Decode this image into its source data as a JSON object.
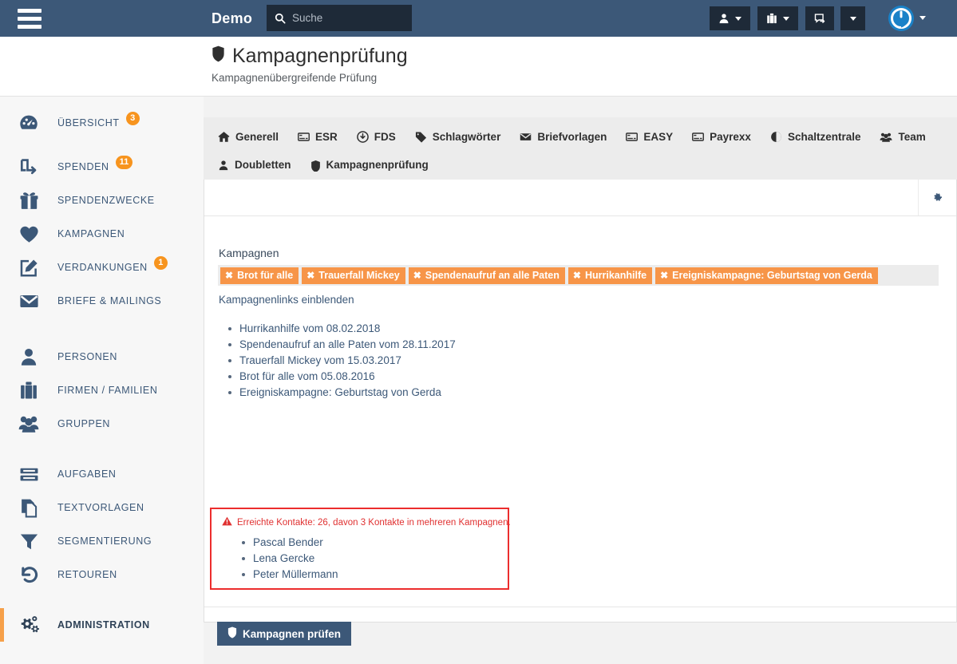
{
  "header": {
    "brand": "Demo",
    "search": {
      "placeholder": "Suche",
      "value": ""
    },
    "buttons": [
      {
        "name": "person-menu",
        "icon": "person-icon"
      },
      {
        "name": "briefcase-menu",
        "icon": "briefcase-icon"
      },
      {
        "name": "comment-button",
        "icon": "comment-arrow-icon"
      },
      {
        "name": "more-menu",
        "icon": "chevron-down-icon"
      }
    ]
  },
  "page": {
    "title": "Kampagnenprüfung",
    "subtitle": "Kampagnenübergreifende Prüfung"
  },
  "sidebar": {
    "items": [
      {
        "label": "ÜBERSICHT",
        "badge": "3",
        "icon": "dashboard-icon",
        "active": false
      },
      {
        "label": "SPENDEN",
        "badge": "11",
        "icon": "donation-icon",
        "active": false
      },
      {
        "label": "SPENDENZWECKE",
        "badge": "",
        "icon": "gift-icon",
        "active": false
      },
      {
        "label": "KAMPAGNEN",
        "badge": "",
        "icon": "heart-icon",
        "active": false
      },
      {
        "label": "VERDANKUNGEN",
        "badge": "1",
        "icon": "edit-note-icon",
        "active": false
      },
      {
        "label": "BRIEFE & MAILINGS",
        "badge": "",
        "icon": "envelope-icon",
        "active": false
      },
      {
        "label": "PERSONEN",
        "badge": "",
        "icon": "user-icon",
        "active": false
      },
      {
        "label": "FIRMEN / FAMILIEN",
        "badge": "",
        "icon": "briefcase-icon",
        "active": false
      },
      {
        "label": "GRUPPEN",
        "badge": "",
        "icon": "group-icon",
        "active": false
      },
      {
        "label": "AUFGABEN",
        "badge": "",
        "icon": "tasks-icon",
        "active": false
      },
      {
        "label": "TEXTVORLAGEN",
        "badge": "",
        "icon": "copy-docs-icon",
        "active": false
      },
      {
        "label": "SEGMENTIERUNG",
        "badge": "",
        "icon": "filter-icon",
        "active": false
      },
      {
        "label": "RETOUREN",
        "badge": "",
        "icon": "undo-icon",
        "active": false
      },
      {
        "label": "ADMINISTRATION",
        "badge": "",
        "icon": "gears-icon",
        "active": true
      }
    ]
  },
  "tabs": [
    {
      "label": "Generell",
      "icon": "home-icon"
    },
    {
      "label": "ESR",
      "icon": "card-icon"
    },
    {
      "label": "FDS",
      "icon": "download-circle-icon"
    },
    {
      "label": "Schlagwörter",
      "icon": "tags-icon"
    },
    {
      "label": "Briefvorlagen",
      "icon": "envelope-icon"
    },
    {
      "label": "EASY",
      "icon": "card-icon"
    },
    {
      "label": "Payrexx",
      "icon": "card-icon"
    },
    {
      "label": "Schaltzentrale",
      "icon": "half-circle-icon"
    },
    {
      "label": "Team",
      "icon": "group-icon"
    },
    {
      "label": "Doubletten",
      "icon": "user-icon"
    },
    {
      "label": "Kampagnenprüfung",
      "icon": "shield-icon"
    }
  ],
  "panel": {
    "gear_icon": "gear-icon",
    "field_label": "Kampagnen",
    "tags": [
      "Brot für alle",
      "Trauerfall Mickey",
      "Spendenaufruf an alle Paten",
      "Hurrikanhilfe",
      "Ereigniskampagne: Geburtstag von Gerda"
    ],
    "toggle_link": "Kampagnenlinks einblenden",
    "campaigns": [
      "Hurrikanhilfe vom 08.02.2018",
      "Spendenaufruf an alle Paten vom 28.11.2017",
      "Trauerfall Mickey vom 15.03.2017",
      "Brot für alle vom 05.08.2016",
      "Ereigniskampagne: Geburtstag von Gerda"
    ],
    "warning": {
      "text": "Erreichte Kontakte: 26, davon 3 Kontakte in mehreren Kampagnen.",
      "contacts": [
        "Pascal Bender",
        "Lena Gercke",
        "Peter Müllermann"
      ]
    },
    "submit_label": "Kampagnen prüfen"
  },
  "colors": {
    "header_bg": "#3c5878",
    "accent_orange": "#f7941e",
    "tag_orange": "#f79548",
    "warning_red": "#ec2d2d",
    "nav_text": "#3c5878"
  }
}
